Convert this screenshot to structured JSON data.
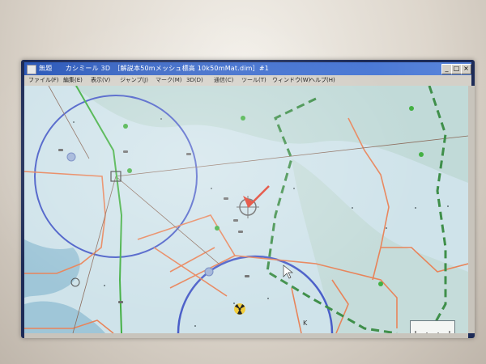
{
  "window": {
    "title": "無題　　カシミール 3D　［解説本50mメッシュ標高 10k50mMat.dim］#1",
    "minimize_label": "_",
    "maximize_label": "□",
    "close_label": "×"
  },
  "menu": {
    "items": [
      {
        "label": "ファイル(F)"
      },
      {
        "label": "編集(E)"
      },
      {
        "label": "表示(V)"
      },
      {
        "label": "ジャンプ(J)"
      },
      {
        "label": "マーク(M)"
      },
      {
        "label": "3D(D)"
      },
      {
        "label": "通信(C)"
      },
      {
        "label": "ツール(T)"
      },
      {
        "label": "ウィンドウ(W)"
      },
      {
        "label": "ヘルプ(H)"
      }
    ]
  },
  "colors": {
    "map_bg": "#cfe3ea",
    "terrain": "#b7d3c8",
    "sea": "#9fc6d8",
    "range_circle": "#4a5ec8",
    "boundary": "#e8845a",
    "route_green": "#43b043",
    "dashed_boundary": "#3f8f4a",
    "road_brown": "#8a6a5a",
    "cursor_red": "#e03a28"
  },
  "map": {
    "icons": [
      "heading-arrow-icon",
      "crosshair-cursor-icon",
      "radiation-hazard-icon",
      "waypoint-marker-icon",
      "mouse-pointer-icon"
    ]
  }
}
